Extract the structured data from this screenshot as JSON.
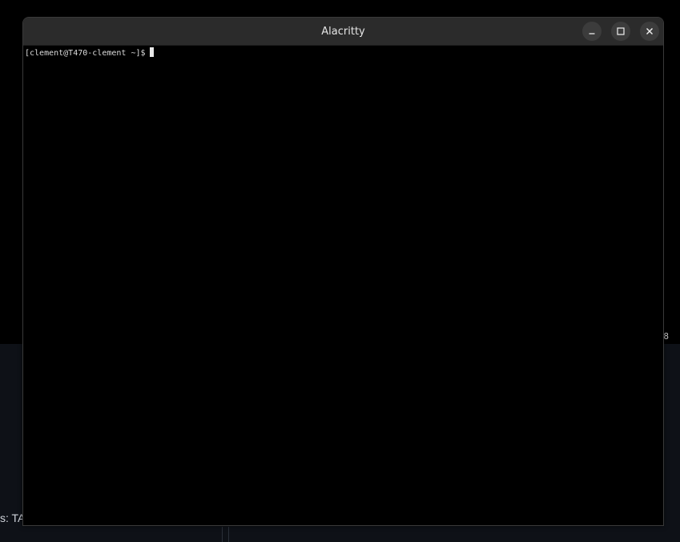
{
  "window": {
    "title": "Alacritty"
  },
  "terminal": {
    "prompt": "[clement@T470-clement ~]$"
  },
  "background": {
    "fragment_right": "8",
    "fragment_left": "s: TA"
  },
  "controls": {
    "minimize_icon": "minimize-icon",
    "maximize_icon": "maximize-icon",
    "close_icon": "close-icon"
  }
}
